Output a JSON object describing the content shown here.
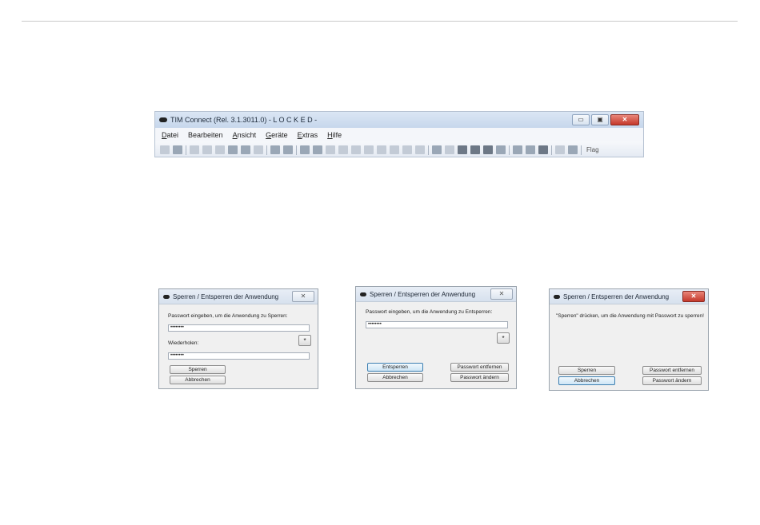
{
  "app": {
    "title": "TIM Connect (Rel. 3.1.3011.0) - L O C K E D -",
    "window_buttons": {
      "minimize": "▭",
      "maximize": "▣",
      "close": "✕"
    },
    "menu": {
      "datei": {
        "accel": "D",
        "rest": "atei"
      },
      "bearbeiten": "Bearbeiten",
      "ansicht": {
        "accel": "A",
        "rest": "nsicht"
      },
      "geraete": {
        "accel": "G",
        "rest": "eräte"
      },
      "extras": {
        "accel": "E",
        "rest": "xtras"
      },
      "hilfe": {
        "accel": "H",
        "rest": "ilfe"
      }
    },
    "toolbar_flag": "Flag"
  },
  "dialog1": {
    "title": "Sperren / Entsperren der Anwendung",
    "close": "✕",
    "prompt": "Passwort eingeben, um die Anwendung zu Sperren:",
    "password_value": "••••••••",
    "repeat_label": "Wiederholen:",
    "repeat_value": "••••••••",
    "star": "*",
    "lock_button": "Sperren",
    "cancel_button": "Abbrechen"
  },
  "dialog2": {
    "title": "Sperren / Entsperren der Anwendung",
    "close": "✕",
    "prompt": "Passwort eingeben, um die Anwendung zu Entsperren:",
    "password_value": "••••••••",
    "star": "*",
    "unlock_button": "Entsperren",
    "remove_password_button": "Passwort entfernen",
    "cancel_button": "Abbrechen",
    "change_password_button": "Passwort ändern"
  },
  "dialog3": {
    "title": "Sperren / Entsperren der Anwendung",
    "close": "✕",
    "prompt": "\"Sperren\" drücken, um die Anwendung mit Passwort zu sperren!",
    "lock_button": "Sperren",
    "remove_password_button": "Passwort entfernen",
    "cancel_button": "Abbrechen",
    "change_password_button": "Passwort ändern"
  }
}
